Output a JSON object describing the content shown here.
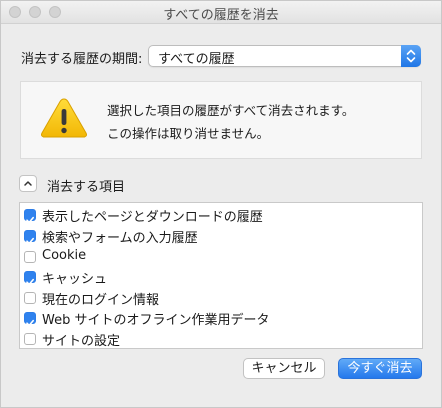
{
  "window": {
    "title": "すべての履歴を消去"
  },
  "range": {
    "label": "消去する履歴の期間:",
    "selected": "すべての履歴"
  },
  "warning": {
    "line1": "選択した項目の履歴がすべて消去されます。",
    "line2": "この操作は取り消せません。"
  },
  "details": {
    "toggle_label": "消去する項目",
    "items": [
      {
        "label": "表示したページとダウンロードの履歴",
        "checked": true
      },
      {
        "label": "検索やフォームの入力履歴",
        "checked": true
      },
      {
        "label": "Cookie",
        "checked": false
      },
      {
        "label": "キャッシュ",
        "checked": true
      },
      {
        "label": "現在のログイン情報",
        "checked": false
      },
      {
        "label": "Web サイトのオフライン作業用データ",
        "checked": true
      },
      {
        "label": "サイトの設定",
        "checked": false
      }
    ]
  },
  "buttons": {
    "cancel": "キャンセル",
    "clear_now": "今すぐ消去"
  },
  "colors": {
    "accent": "#2f82ee",
    "warning_yellow": "#f5c400"
  }
}
